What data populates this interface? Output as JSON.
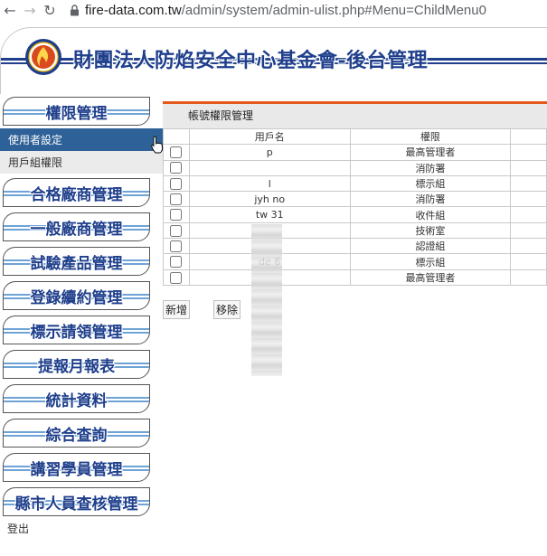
{
  "browser": {
    "url_host": "fire-data.com.tw",
    "url_path": "/admin/system/admin-ulist.php#Menu=ChildMenu0"
  },
  "banner": {
    "title": "財團法人防焰安全中心基金會-後台管理"
  },
  "sidebar": {
    "menus": [
      "權限管理",
      "合格廠商管理",
      "一般廠商管理",
      "試驗產品管理",
      "登錄續約管理",
      "標示請領管理",
      "提報月報表",
      "統計資料",
      "綜合查詢",
      "講習學員管理",
      "縣市人員查核管理"
    ],
    "submenu": [
      "使用者設定",
      "用戶組權限"
    ],
    "active_submenu": "使用者設定",
    "logout": "登出"
  },
  "main": {
    "title": "帳號權限管理",
    "columns": [
      "",
      "用戶名",
      "權限",
      ""
    ],
    "rows": [
      {
        "user": "p          ",
        "role": "最高管理者"
      },
      {
        "user": "",
        "role": "消防署"
      },
      {
        "user": "l",
        "role": "標示組"
      },
      {
        "user": "jyh       no",
        "role": "消防署"
      },
      {
        "user": "tw        31",
        "role": "收件組"
      },
      {
        "user": "",
        "role": "技術室"
      },
      {
        "user": "",
        "role": "認證組"
      },
      {
        "user": "de       6",
        "role": "標示組"
      },
      {
        "user": "",
        "role": "最高管理者"
      }
    ],
    "buttons": {
      "add": "新增",
      "remove": "移除"
    }
  },
  "colors": {
    "accent_blue": "#1f3f8c",
    "active_menu_bg": "#2e6197",
    "title_bar_border": "#e45a1d"
  }
}
